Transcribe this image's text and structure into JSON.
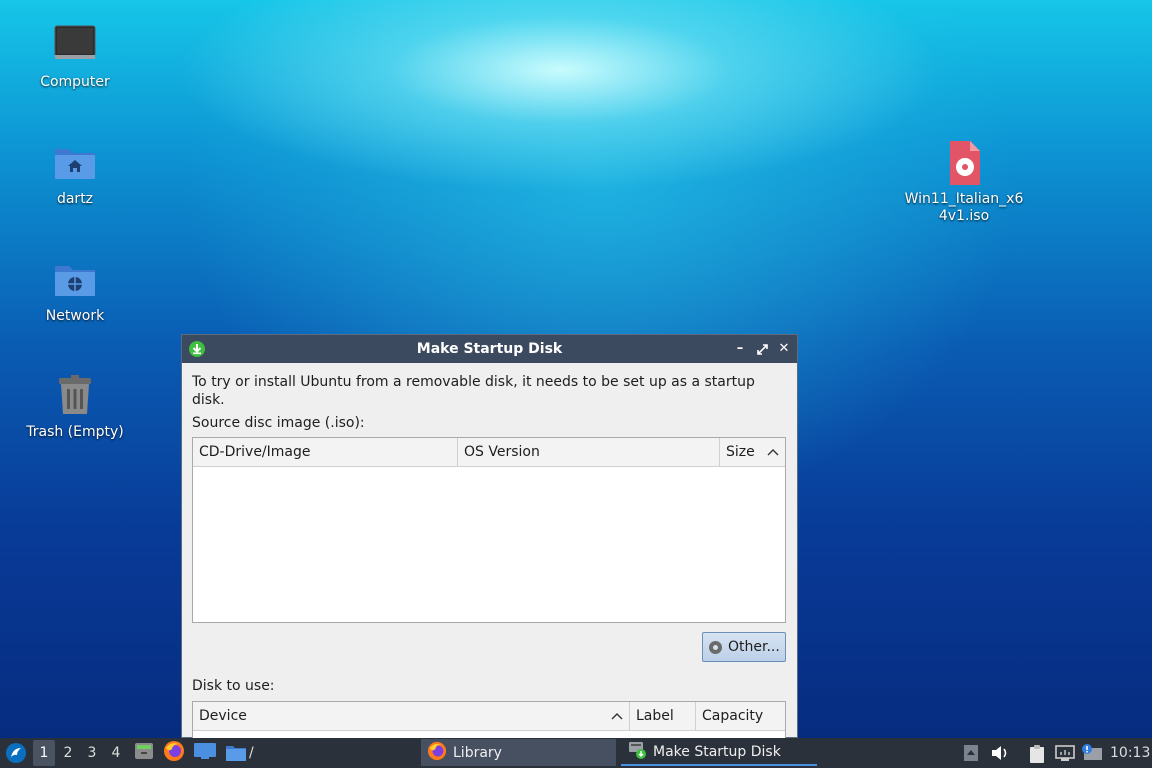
{
  "desktop": {
    "icons": [
      {
        "label": "Computer",
        "icon": "computer-icon"
      },
      {
        "label": "dartz",
        "icon": "home-folder-icon"
      },
      {
        "label": "Network",
        "icon": "network-folder-icon"
      },
      {
        "label": "Trash (Empty)",
        "icon": "trash-icon"
      },
      {
        "label": "Win11_Italian_x64v1.iso",
        "icon": "iso-file-icon"
      }
    ]
  },
  "window": {
    "title": "Make Startup Disk",
    "intro": "To try or install Ubuntu from a removable disk, it needs to be set up as a startup disk.",
    "source_label": "Source disc image (.iso):",
    "source_table": {
      "columns": [
        "CD-Drive/Image",
        "OS Version",
        "Size"
      ],
      "rows": []
    },
    "other_button": "Other...",
    "disk_label": "Disk to use:",
    "disk_table": {
      "columns": [
        "Device",
        "Label",
        "Capacity"
      ],
      "rows": []
    }
  },
  "taskbar": {
    "workspaces": [
      "1",
      "2",
      "3",
      "4"
    ],
    "active_workspace": "1",
    "launch_path": "/",
    "tasks": [
      {
        "label": "Library",
        "icon": "firefox-icon"
      },
      {
        "label": "Make Startup Disk",
        "icon": "startup-disk-icon"
      }
    ],
    "clock": "10:13"
  },
  "colors": {
    "titlebar": "#3c4a60",
    "taskbar": "#2b313a",
    "accent": "#4a90e2"
  }
}
